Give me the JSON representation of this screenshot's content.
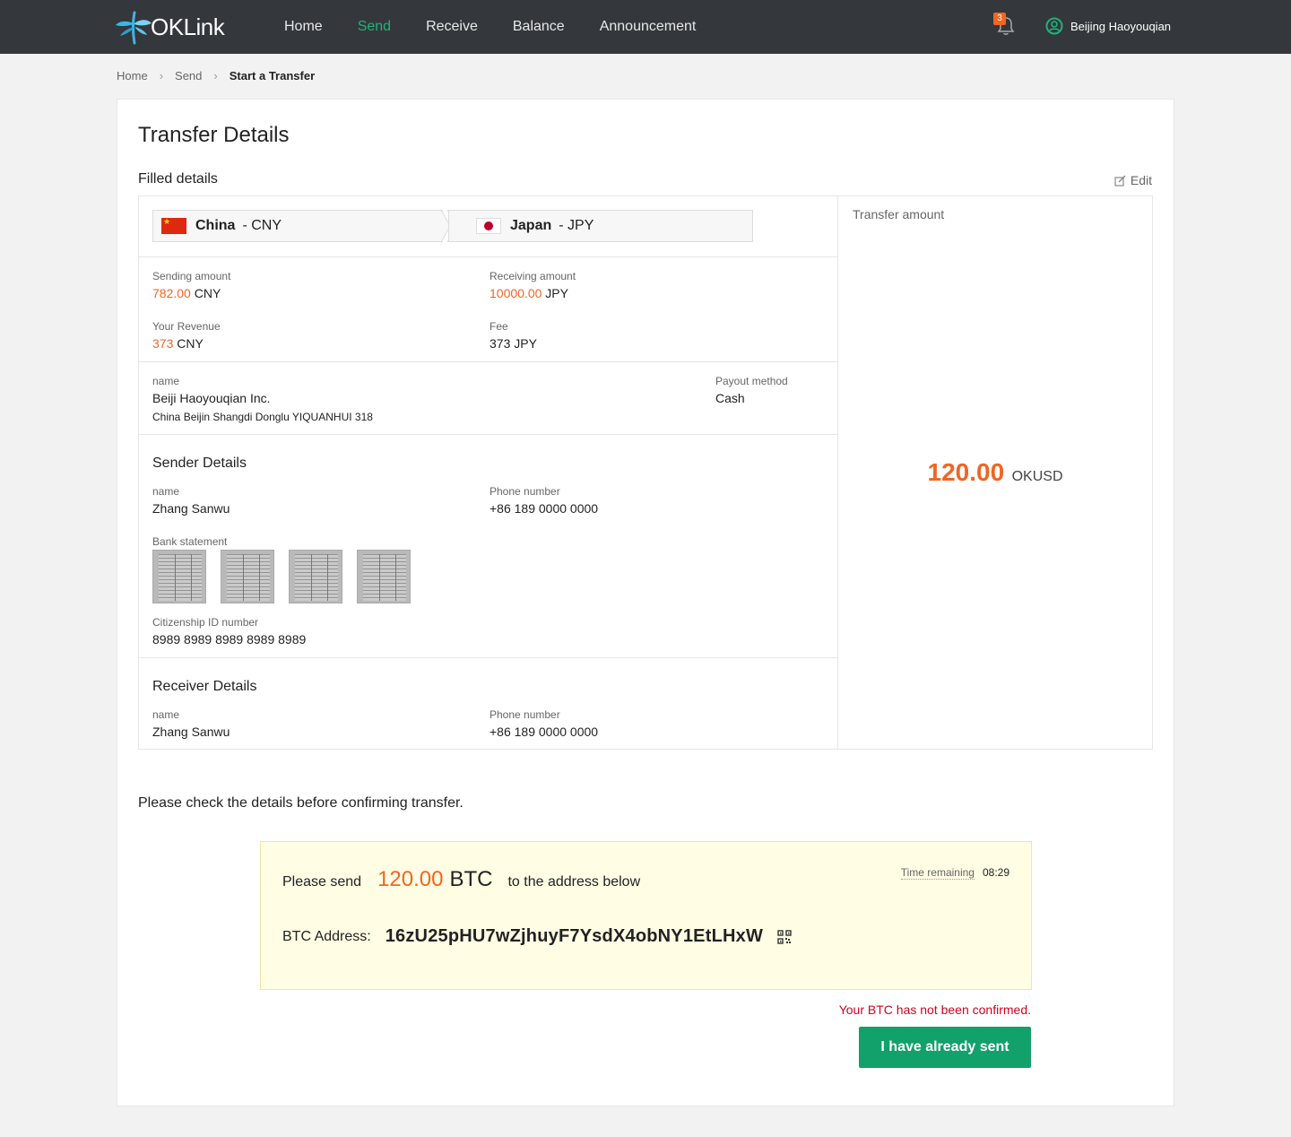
{
  "app": {
    "logo_text": "OKLink"
  },
  "nav": {
    "items": [
      {
        "label": "Home",
        "active": false
      },
      {
        "label": "Send",
        "active": true
      },
      {
        "label": "Receive",
        "active": false
      },
      {
        "label": "Balance",
        "active": false
      },
      {
        "label": "Announcement",
        "active": false
      }
    ],
    "notifications_count": "3",
    "user_name": "Beijing  Haoyouqian"
  },
  "breadcrumb": {
    "items": [
      "Home",
      "Send"
    ],
    "current": "Start a Transfer"
  },
  "page": {
    "title": "Transfer Details",
    "filled_title": "Filled details",
    "edit_label": "Edit"
  },
  "route": {
    "from": {
      "country": "China",
      "currency": "- CNY"
    },
    "to": {
      "country": "Japan",
      "currency": "- JPY"
    }
  },
  "amounts": {
    "sending_label": "Sending amount",
    "sending_value": "782.00",
    "sending_currency": "CNY",
    "receiving_label": "Receiving amount",
    "receiving_value": "10000.00",
    "receiving_currency": "JPY",
    "revenue_label": "Your Revenue",
    "revenue_value": "373",
    "revenue_currency": "CNY",
    "fee_label": "Fee",
    "fee_value": "373 JPY"
  },
  "payee": {
    "name_label": "name",
    "name": "Beiji Haoyouqian Inc.",
    "address": "China  Beijin  Shangdi Donglu YIQUANHUI 318",
    "payout_label": "Payout method",
    "payout_value": "Cash"
  },
  "sender": {
    "title": "Sender Details",
    "name_label": "name",
    "name": "Zhang Sanwu",
    "phone_label": "Phone number",
    "phone": "+86 189 0000 0000",
    "bank_label": "Bank statement",
    "id_label": "Citizenship ID number",
    "id_value": "8989 8989 8989 8989 8989"
  },
  "receiver": {
    "title": "Receiver Details",
    "name_label": "name",
    "name": "Zhang Sanwu",
    "phone_label": "Phone number",
    "phone": "+86 189 0000 0000"
  },
  "transfer": {
    "label": "Transfer amount",
    "value": "120.00",
    "unit": "OKUSD"
  },
  "confirm": {
    "check_text": "Please check the details before confirming transfer.",
    "send_prefix": "Please send",
    "send_amount": "120.00",
    "send_currency": "BTC",
    "send_suffix": "to the address below",
    "time_label": "Time remaining",
    "time_value": "08:29",
    "address_label": "BTC Address:",
    "address_value": "16zU25pHU7wZjhuyF7YsdX4obNY1EtLHxW",
    "status_text": "Your BTC has not been confirmed.",
    "button_label": "I have already sent"
  },
  "colors": {
    "accent_green": "#1fb37a",
    "button_green": "#12a06b",
    "orange": "#f26522",
    "error_red": "#d0021b",
    "topbar": "#34373b"
  }
}
